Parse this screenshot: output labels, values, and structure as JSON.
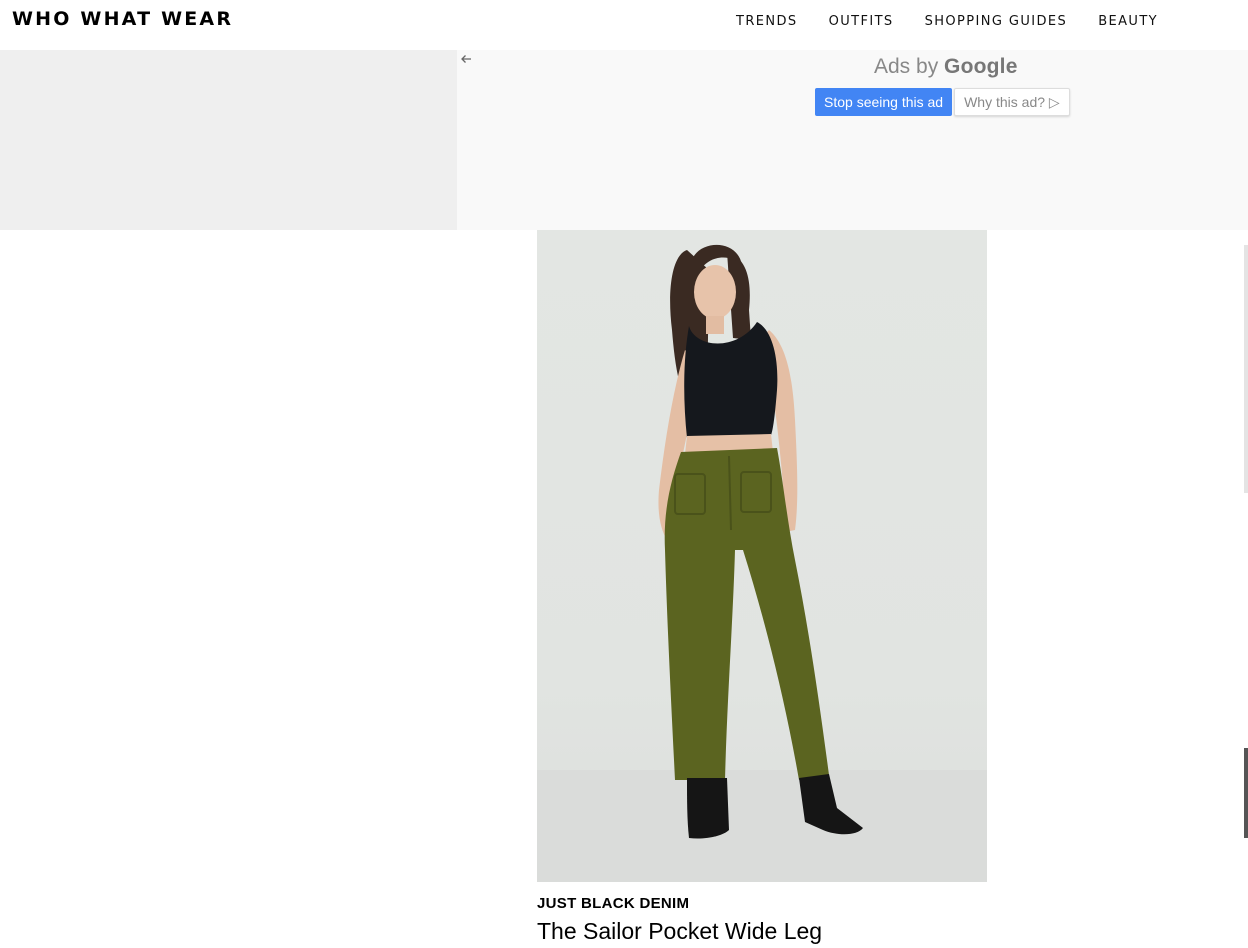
{
  "header": {
    "logo": "WHO WHAT WEAR",
    "nav": [
      "TRENDS",
      "OUTFITS",
      "SHOPPING GUIDES",
      "BEAUTY"
    ]
  },
  "ad": {
    "back_icon": "arrow-left-icon",
    "ads_by_prefix": "Ads by",
    "ads_by_brand": "Google",
    "stop_label": "Stop seeing this ad",
    "why_label": "Why this ad? ▷",
    "stop_color": "#4285f4"
  },
  "product": {
    "brand": "JUST BLACK DENIM",
    "name": "The Sailor Pocket Wide Leg",
    "pants_color": "#5b6420"
  }
}
